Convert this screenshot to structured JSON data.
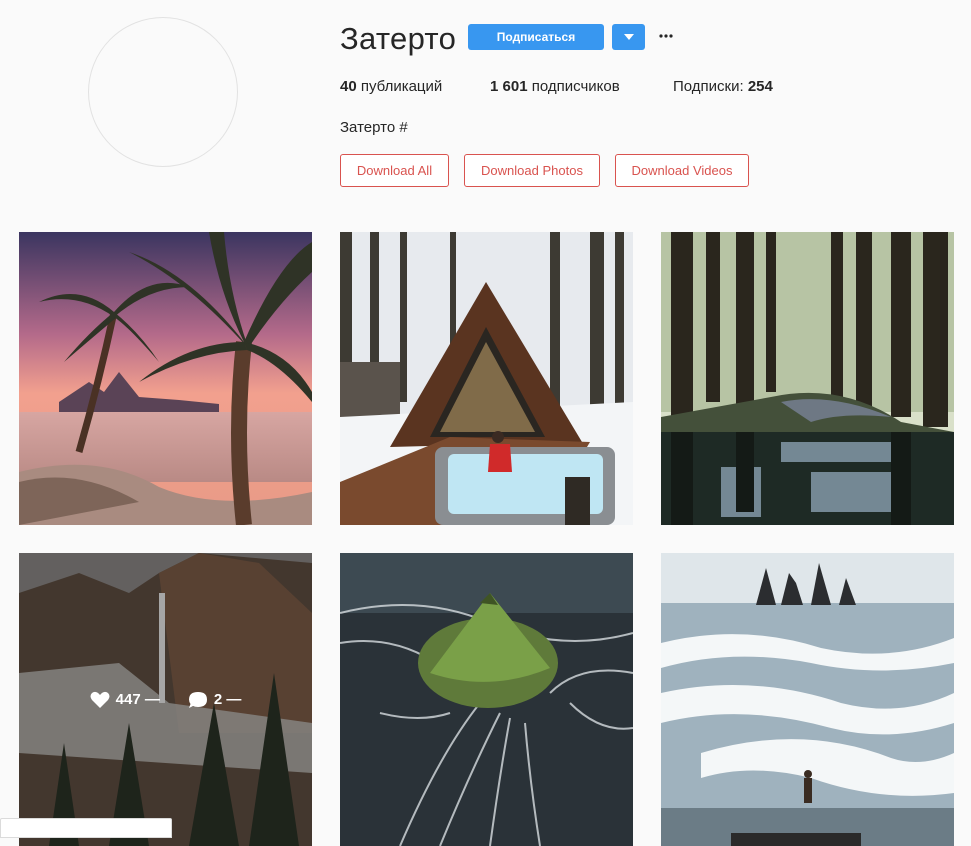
{
  "profile": {
    "username": "Затерто",
    "follow_label": "Подписаться",
    "bio": "Затерто #"
  },
  "stats": {
    "posts_count": "40",
    "posts_label": "публикаций",
    "followers_count": "1 601",
    "followers_label": "подписчиков",
    "following_label": "Подписки:",
    "following_count": "254"
  },
  "downloads": {
    "all": "Download All",
    "photos": "Download Photos",
    "videos": "Download Videos"
  },
  "colors": {
    "accent": "#3897f0",
    "download_border": "#d9534f"
  },
  "grid": {
    "posts": [
      {
        "subject": "tropical beach sunset with palm trees"
      },
      {
        "subject": "a-frame cabin with hot tub in snowy forest"
      },
      {
        "subject": "forest road reflected in water"
      },
      {
        "subject": "misty waterfall canyon",
        "likes": "447 —",
        "comments": "2 —"
      },
      {
        "subject": "aerial green volcano with braided rivers"
      },
      {
        "subject": "rough sea waves with sea stacks"
      }
    ]
  },
  "icons": {
    "dropdown": "caret-down-icon",
    "more": "more-dots-icon",
    "heart": "heart-icon",
    "comment": "comment-bubble-icon"
  }
}
